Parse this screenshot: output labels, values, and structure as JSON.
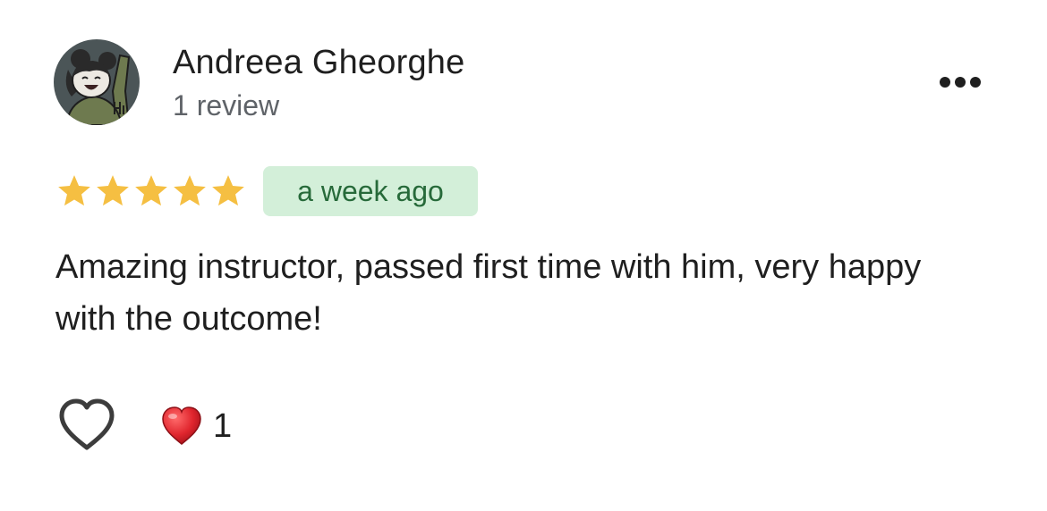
{
  "review": {
    "author_name": "Andreea Gheorghe",
    "review_count": "1 review",
    "rating": 5,
    "rating_max": 5,
    "date": "a week ago",
    "text": "Amazing instructor, passed first time with him, very happy with the outcome!"
  },
  "actions": {
    "more_icon": "more-horizontal-icon",
    "like_icon": "heart-outline-icon",
    "reaction_icon": "red-heart-emoji",
    "reaction_count": "1"
  },
  "colors": {
    "star": "#f5bf42",
    "date_badge_bg": "#d3efd9",
    "date_badge_text": "#276a3a",
    "reaction_heart": "#e0262e"
  }
}
